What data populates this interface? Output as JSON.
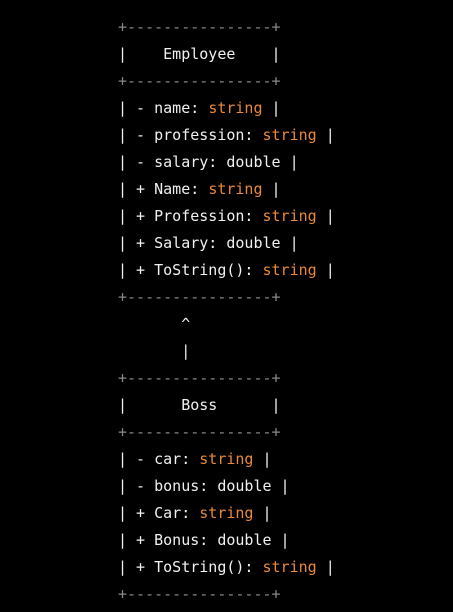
{
  "diagram": {
    "separator": "+----------------+",
    "employee": {
      "title_line": "|    Employee    |",
      "members": [
        {
          "prefix": "| - name: ",
          "type": "string",
          "suffix": " |"
        },
        {
          "prefix": "| - profession: ",
          "type": "string",
          "suffix": " |"
        },
        {
          "prefix": "| - salary: double |",
          "type": "",
          "suffix": ""
        },
        {
          "prefix": "| + Name: ",
          "type": "string",
          "suffix": " |"
        },
        {
          "prefix": "| + Profession: ",
          "type": "string",
          "suffix": " |"
        },
        {
          "prefix": "| + Salary: double |",
          "type": "",
          "suffix": ""
        },
        {
          "prefix": "| + ToString(): ",
          "type": "string",
          "suffix": " |"
        }
      ]
    },
    "arrow": {
      "head": "       ^",
      "shaft": "       |"
    },
    "boss": {
      "title_line": "|      Boss      |",
      "members": [
        {
          "prefix": "| - car: ",
          "type": "string",
          "suffix": " |"
        },
        {
          "prefix": "| - bonus: double |",
          "type": "",
          "suffix": ""
        },
        {
          "prefix": "| + Car: ",
          "type": "string",
          "suffix": " |"
        },
        {
          "prefix": "| + Bonus: double |",
          "type": "",
          "suffix": ""
        },
        {
          "prefix": "| + ToString(): ",
          "type": "string",
          "suffix": " |"
        }
      ]
    },
    "colors": {
      "background": "#000000",
      "text": "#f0f0f0",
      "type_keyword": "#e8893a",
      "border": "#8a8a8a"
    }
  }
}
